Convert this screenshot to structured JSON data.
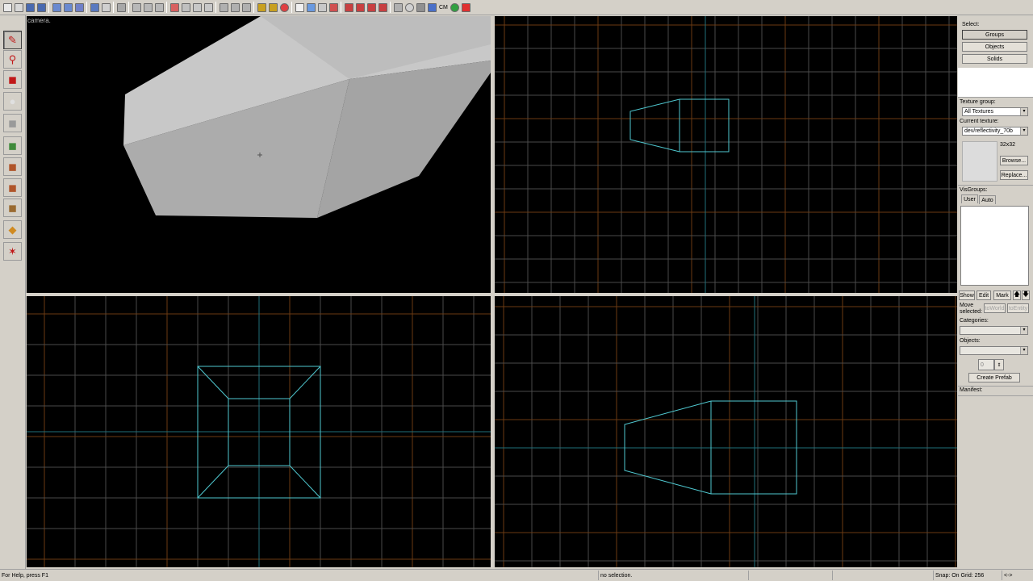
{
  "camera": {
    "label": "camera."
  },
  "palette": {
    "tools": [
      {
        "name": "selection-tool",
        "icon": "pointer-icon",
        "color": "#c01818",
        "active": true
      },
      {
        "name": "magnify-tool",
        "icon": "magnify-icon",
        "color": "#c01818"
      },
      {
        "name": "camera-tool",
        "icon": "camera-icon",
        "color": "#c01818"
      },
      {
        "name": "entity-tool",
        "icon": "entity-icon",
        "color": "#e0e0e0"
      },
      {
        "name": "block-tool",
        "icon": "block-icon",
        "color": "#9a9a9a"
      },
      {
        "name": "texture-application-tool",
        "icon": "texture-apply-icon",
        "color": "#3f8a3a"
      },
      {
        "name": "apply-current-texture-tool",
        "icon": "apply-texture-icon",
        "color": "#b0552a"
      },
      {
        "name": "decal-tool",
        "icon": "decal-icon",
        "color": "#b0552a"
      },
      {
        "name": "overlay-tool",
        "icon": "overlay-icon",
        "color": "#9a6a30"
      },
      {
        "name": "clipping-tool",
        "icon": "clip-icon",
        "color": "#d08a20"
      },
      {
        "name": "vertex-tool",
        "icon": "vertex-icon",
        "color": "#c01818"
      }
    ]
  },
  "toolbar": {
    "cm_label": "CM"
  },
  "select_panel": {
    "title": "Select:",
    "groups": "Groups",
    "objects": "Objects",
    "solids": "Solids"
  },
  "texture_panel": {
    "group_label": "Texture group:",
    "group_value": "All Textures",
    "current_label": "Current texture:",
    "current_value": "dev/reflectivity_70b",
    "size": "32x32",
    "browse": "Browse...",
    "replace": "Replace..."
  },
  "visgroups": {
    "label": "VisGroups:",
    "tab_user": "User",
    "tab_auto": "Auto",
    "show": "Show",
    "edit": "Edit",
    "mark": "Mark"
  },
  "prefab_panel": {
    "move_selected": "Move selected:",
    "to_world": "toWorld",
    "to_entity": "toEntity",
    "categories_label": "Categories:",
    "objects_label": "Objects:",
    "count": "0",
    "create_prefab": "Create Prefab",
    "manifest_label": "Manifest:"
  },
  "status": {
    "help": "For Help, press F1",
    "selection": "no selection.",
    "snap": "Snap: On Grid: 256",
    "nav": "<->"
  },
  "colors": {
    "grid": "#4a4a4a",
    "grid_major": "#6b3a12",
    "axis": "#1f6f7a",
    "wire": "#4fc8d0",
    "solid_face_light": "#c8c8c8",
    "solid_face_mid": "#b0b0b0",
    "solid_face_dark": "#9a9a9a"
  }
}
